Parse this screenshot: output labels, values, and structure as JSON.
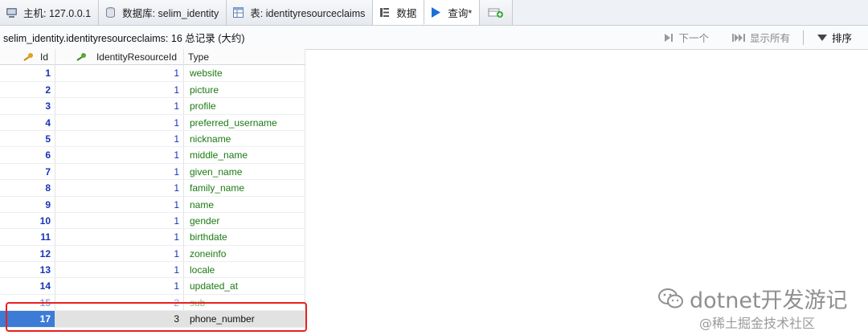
{
  "tabs": [
    {
      "icon": "server-icon",
      "label": "主机: 127.0.0.1"
    },
    {
      "icon": "database-icon",
      "label": "数据库: selim_identity"
    },
    {
      "icon": "table-icon",
      "label": "表: identityresourceclaims"
    },
    {
      "icon": "data-grid-icon",
      "label": "数据"
    },
    {
      "icon": "play-icon",
      "label": "查询*"
    },
    {
      "icon": "new-query-tab-icon",
      "label": ""
    }
  ],
  "infobar": {
    "text": "selim_identity.identityresourceclaims: 16 总记录 (大约)",
    "next_label": "下一个",
    "show_all_label": "显示所有",
    "sort_label": "排序"
  },
  "grid": {
    "columns": [
      "Id",
      "IdentityResourceId",
      "Type"
    ],
    "rows": [
      {
        "id": "1",
        "resource_id": "1",
        "type": "website"
      },
      {
        "id": "2",
        "resource_id": "1",
        "type": "picture"
      },
      {
        "id": "3",
        "resource_id": "1",
        "type": "profile"
      },
      {
        "id": "4",
        "resource_id": "1",
        "type": "preferred_username"
      },
      {
        "id": "5",
        "resource_id": "1",
        "type": "nickname"
      },
      {
        "id": "6",
        "resource_id": "1",
        "type": "middle_name"
      },
      {
        "id": "7",
        "resource_id": "1",
        "type": "given_name"
      },
      {
        "id": "8",
        "resource_id": "1",
        "type": "family_name"
      },
      {
        "id": "9",
        "resource_id": "1",
        "type": "name"
      },
      {
        "id": "10",
        "resource_id": "1",
        "type": "gender"
      },
      {
        "id": "11",
        "resource_id": "1",
        "type": "birthdate"
      },
      {
        "id": "12",
        "resource_id": "1",
        "type": "zoneinfo"
      },
      {
        "id": "13",
        "resource_id": "1",
        "type": "locale"
      },
      {
        "id": "14",
        "resource_id": "1",
        "type": "updated_at"
      },
      {
        "id": "15",
        "resource_id": "2",
        "type": "sub"
      },
      {
        "id": "17",
        "resource_id": "3",
        "type": "phone_number"
      }
    ],
    "selected_row_id": "17"
  },
  "watermark": {
    "line1": "dotnet开发游记",
    "line2": "@稀土掘金技术社区"
  },
  "colors": {
    "id_text": "#1533b8",
    "type_text": "#1a7a12",
    "selection": "#3c7bd6",
    "highlight_box": "#e8201f"
  }
}
